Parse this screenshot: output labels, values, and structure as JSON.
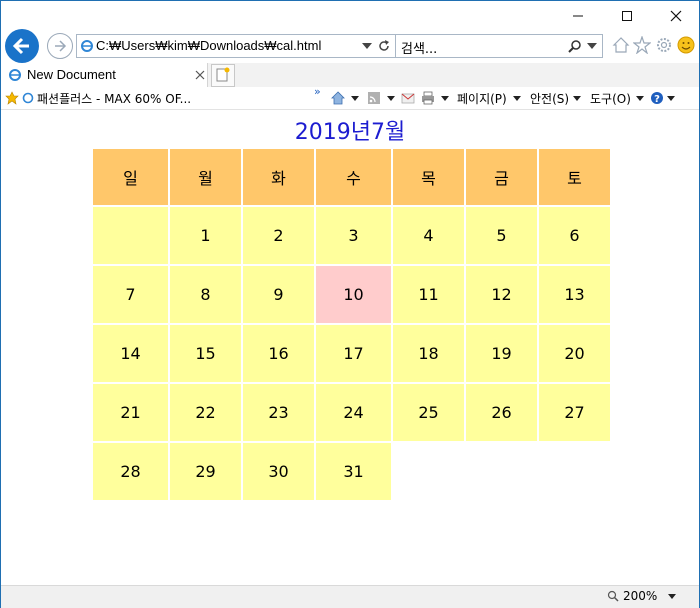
{
  "browser": {
    "url": "C:₩Users₩kim₩Downloads₩cal.html",
    "search_placeholder": "검색...",
    "tab_title": "New Document",
    "favorite_label": "패션플러스 - MAX 60% OF...",
    "commands": {
      "page": "페이지(P)",
      "safety": "안전(S)",
      "tools": "도구(O)"
    },
    "zoom": "200%"
  },
  "calendar": {
    "title": "2019년7월",
    "weekdays": [
      "일",
      "월",
      "화",
      "수",
      "목",
      "금",
      "토"
    ],
    "weeks": [
      [
        "",
        "1",
        "2",
        "3",
        "4",
        "5",
        "6"
      ],
      [
        "7",
        "8",
        "9",
        "10",
        "11",
        "12",
        "13"
      ],
      [
        "14",
        "15",
        "16",
        "17",
        "18",
        "19",
        "20"
      ],
      [
        "21",
        "22",
        "23",
        "24",
        "25",
        "26",
        "27"
      ],
      [
        "28",
        "29",
        "30",
        "31",
        "",
        "",
        ""
      ]
    ],
    "highlight_day": "10"
  },
  "colors": {
    "title": "#1c1cd0",
    "header_bg": "#ffc76a",
    "cell_bg": "#ffff9c",
    "today_bg": "#ffcccc",
    "accent": "#1a73c9"
  }
}
